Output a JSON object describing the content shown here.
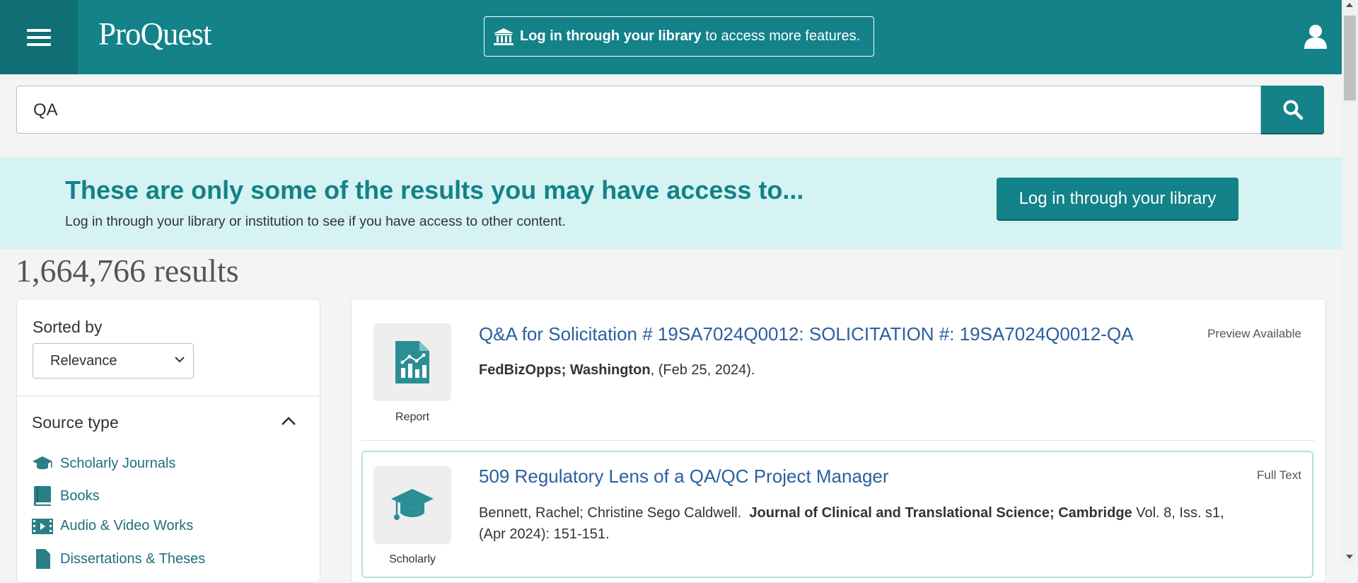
{
  "header": {
    "logo": "ProQuest",
    "login_bold": "Log in through your library",
    "login_rest": " to access more features."
  },
  "search": {
    "query": "QA"
  },
  "access_banner": {
    "title": "These are only some of the results you may have access to...",
    "subtitle": "Log in through your library or institution to see if you have access to other content.",
    "button": "Log in through your library"
  },
  "results_count": "1,664,766 results",
  "sidebar": {
    "sort_label": "Sorted by",
    "sort_value": "Relevance",
    "source_title": "Source type",
    "items": [
      {
        "label": "Scholarly Journals",
        "icon": "mortarboard-icon"
      },
      {
        "label": "Books",
        "icon": "book-icon"
      },
      {
        "label": "Audio & Video Works",
        "icon": "film-icon"
      },
      {
        "label": "Dissertations & Theses",
        "icon": "document-icon"
      }
    ]
  },
  "results": [
    {
      "title": "Q&A for Solicitation # 19SA7024Q0012: SOLICITATION #: 19SA7024Q0012-QA",
      "availability": "Preview Available",
      "type": "Report",
      "meta_bold": "FedBizOpps; Washington",
      "meta_rest": ", (Feb 25, 2024)."
    },
    {
      "title": "509 Regulatory Lens of a QA/QC Project Manager",
      "availability": "Full Text",
      "type": "Scholarly",
      "authors": "Bennett, Rachel; Christine Sego Caldwell.  ",
      "meta_bold": "Journal of Clinical and Translational Science; Cambridge",
      "meta_rest": " Vol. 8, Iss. s1,",
      "meta_line2": "(Apr 2024): 151-151."
    }
  ],
  "colors": {
    "brand": "#138289",
    "banner_bg": "#d5f3f2",
    "link": "#2a5f9e"
  }
}
